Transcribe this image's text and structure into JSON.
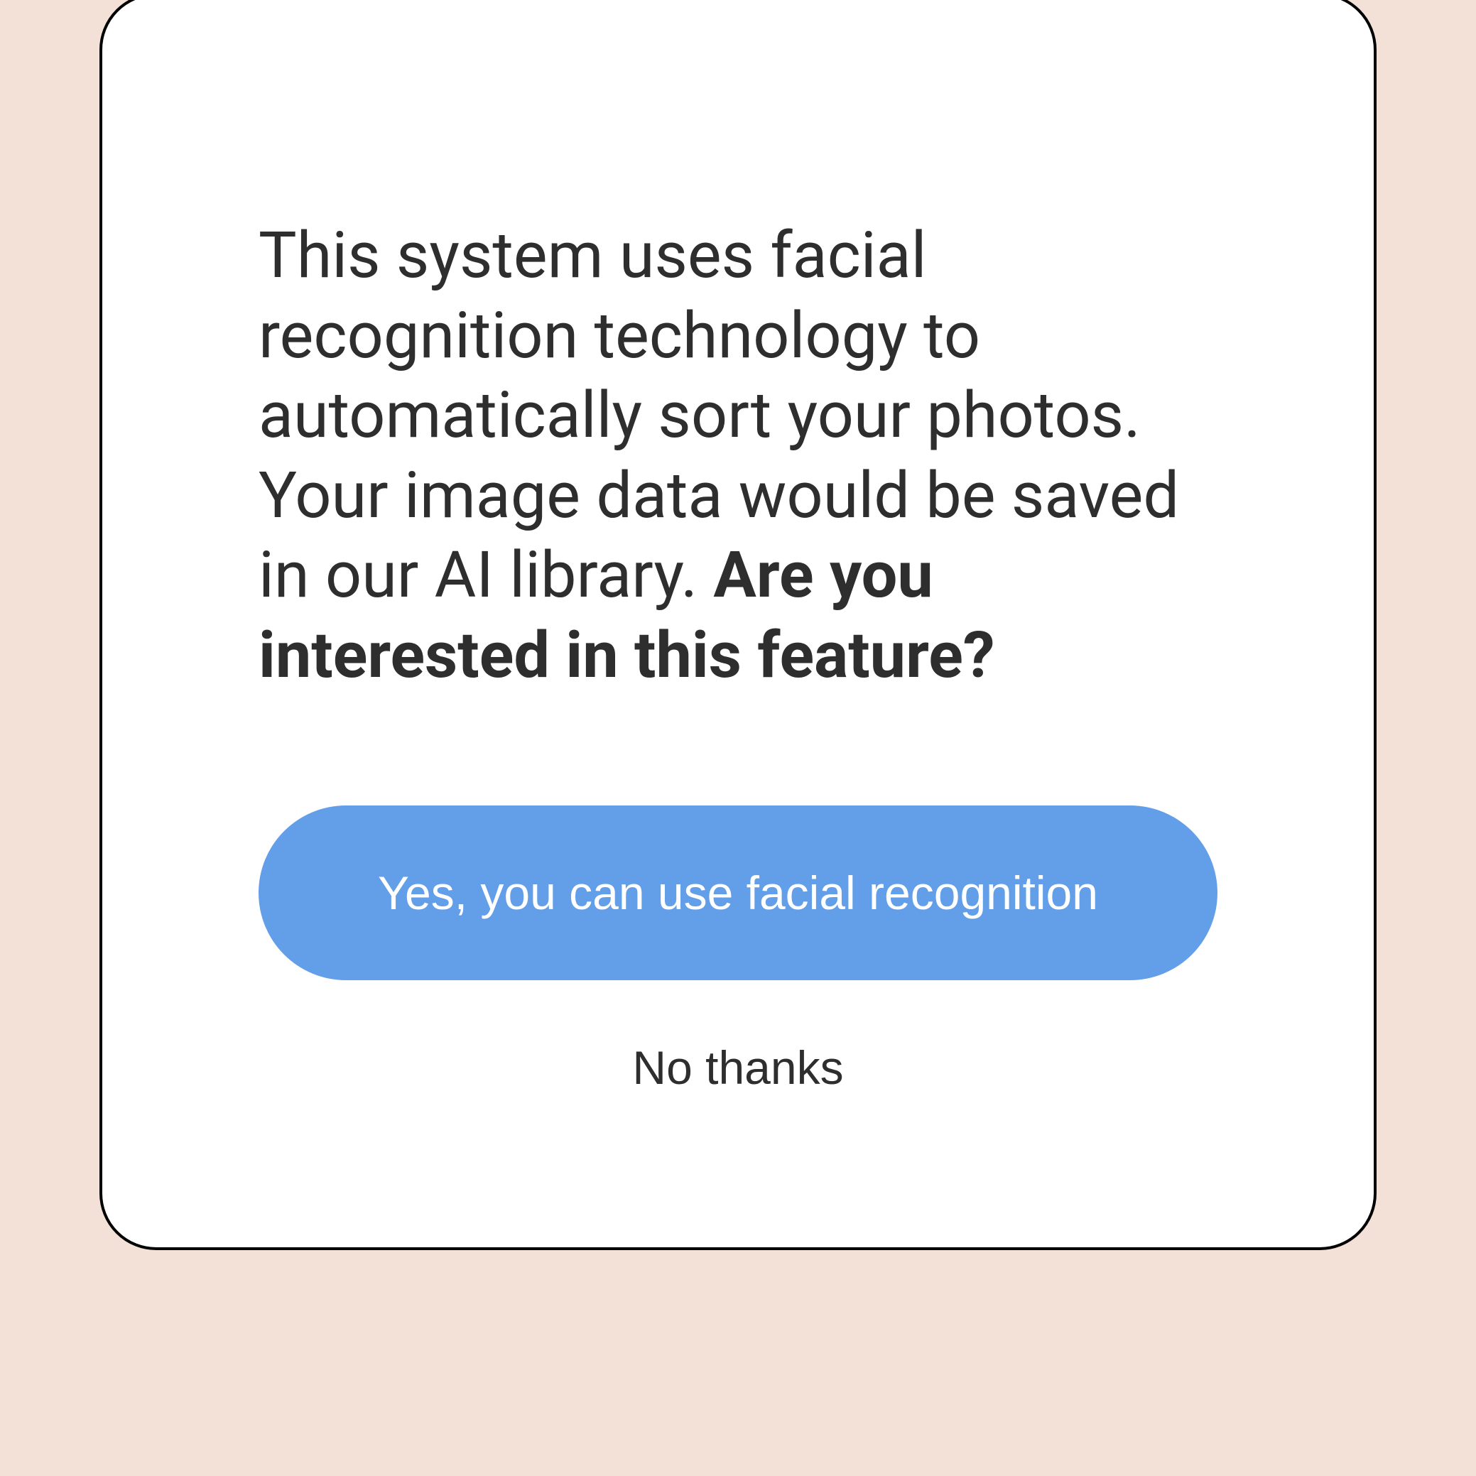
{
  "dialog": {
    "body_plain": "This system uses facial recognition technology to automatically sort your photos. Your image data would be saved in our AI library. ",
    "body_bold": "Are you interested in this feature?",
    "primary_label": "Yes, you can use facial recognition",
    "secondary_label": "No thanks"
  },
  "colors": {
    "background": "#f3e0d6",
    "card_bg": "#ffffff",
    "text": "#2e2e2e",
    "primary_button_bg": "#639ee8",
    "primary_button_text": "#ffffff"
  }
}
